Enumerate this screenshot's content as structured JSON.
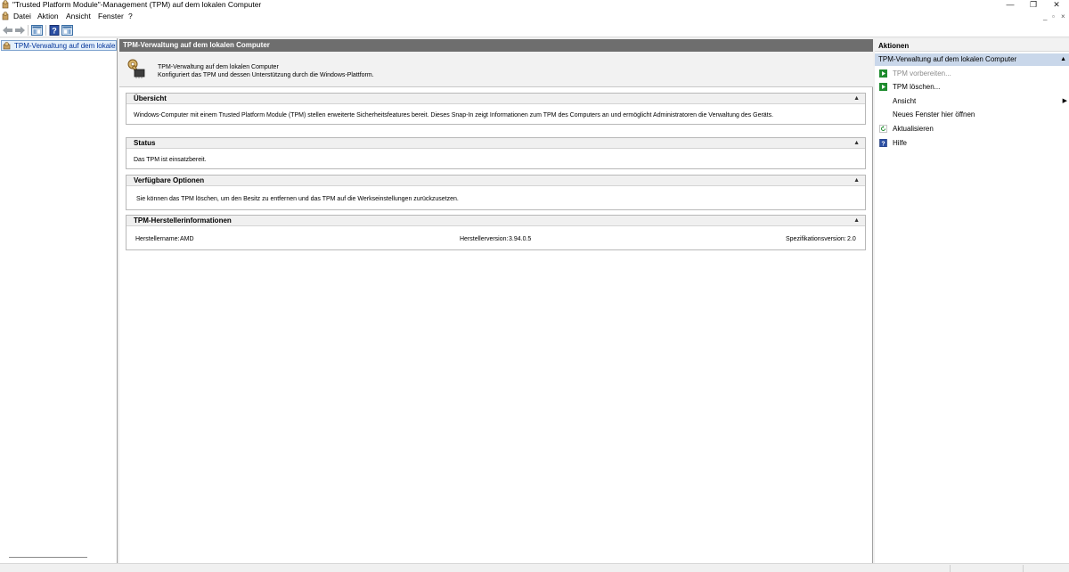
{
  "window": {
    "title": "\"Trusted Platform Module\"-Management (TPM) auf dem lokalen Computer",
    "controls": {
      "minimize": "—",
      "restore": "❐",
      "close": "✕"
    }
  },
  "menu": {
    "items": [
      "Datei",
      "Aktion",
      "Ansicht",
      "Fenster",
      "?"
    ],
    "child_controls": {
      "minimize": "_",
      "restore": "▫",
      "close": "×"
    }
  },
  "toolbar": {
    "icons": [
      "back-arrow-icon",
      "forward-arrow-icon",
      "show-hide-tree-icon",
      "help-icon",
      "show-hide-action-pane-icon"
    ]
  },
  "tree": {
    "selected_label": "TPM-Verwaltung auf dem lokalen Computer"
  },
  "center": {
    "header": "TPM-Verwaltung auf dem lokalen Computer",
    "intro": {
      "line1": "TPM-Verwaltung auf dem lokalen Computer",
      "line2": "Konfiguriert das TPM und dessen Unterstützung durch die Windows-Plattform."
    },
    "sections": {
      "overview": {
        "title": "Übersicht",
        "text": "Windows-Computer mit einem Trusted Platform Module (TPM) stellen erweiterte Sicherheitsfeatures bereit. Dieses Snap-In zeigt Informationen zum TPM des Computers an und ermöglicht Administratoren die Verwaltung des Geräts."
      },
      "status": {
        "title": "Status",
        "text": "Das TPM ist einsatzbereit."
      },
      "options": {
        "title": "Verfügbare Optionen",
        "text": "Sie können das TPM löschen, um den Besitz zu entfernen und das TPM auf die Werkseinstellungen zurückzusetzen."
      },
      "manufacturer": {
        "title": "TPM-Herstellerinformationen",
        "name_label": "Herstellername:",
        "name_value": "AMD",
        "version_label": "Herstellerversion:",
        "version_value": "3.94.0.5",
        "spec_label": "Spezifikationsversion:",
        "spec_value": "2.0"
      }
    },
    "collapse_glyph": "▲"
  },
  "actions": {
    "title": "Aktionen",
    "group": "TPM-Verwaltung auf dem lokalen Computer",
    "group_arrow": "▲",
    "submenu_arrow": "▶",
    "items": [
      {
        "label": "TPM vorbereiten...",
        "icon": "run-green-icon",
        "enabled": false
      },
      {
        "label": "TPM löschen...",
        "icon": "run-green-icon",
        "enabled": true
      },
      {
        "label": "Ansicht",
        "icon": "",
        "enabled": true
      },
      {
        "label": "Neues Fenster hier öffnen",
        "icon": "",
        "enabled": true
      },
      {
        "label": "Aktualisieren",
        "icon": "refresh-icon",
        "enabled": true
      },
      {
        "label": "Hilfe",
        "icon": "help-icon",
        "enabled": true
      }
    ]
  },
  "colors": {
    "center_header_bg": "#6e6e6e",
    "action_group_bg": "#c9d7ea",
    "tree_selection_bg": "#e5f0fb",
    "run_icon_green": "#1e8c2e",
    "help_icon_blue": "#2b4fa3"
  }
}
